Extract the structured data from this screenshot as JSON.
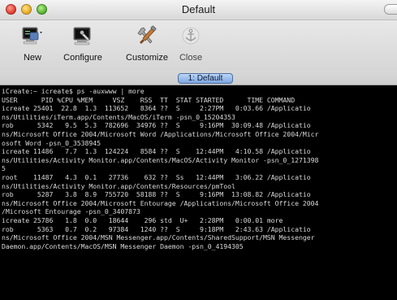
{
  "window": {
    "title": "Default"
  },
  "toolbar": {
    "new_label": "New",
    "configure_label": "Configure",
    "customize_label": "Customize",
    "close_label": "Close"
  },
  "tabs": [
    {
      "label": "1: Default"
    }
  ],
  "terminal": {
    "lines": [
      "iCreate:~ icreate$ ps -auxwww | more",
      "USER      PID %CPU %MEM     VSZ    RSS  TT  STAT STARTED      TIME COMMAND",
      "icreate 25401  22.8  1.3  113652   8364 ??  S     2:27PM   0:03.66 /Applicatio",
      "ns/Utilities/iTerm.app/Contents/MacOS/iTerm -psn_0_15204353",
      "rob      5342   9.5  5.3  782696  34976 ??  S     9:16PM  30:09.48 /Applicatio",
      "ns/Microsoft Office 2004/Microsoft Word /Applications/Microsoft Office 2004/Micr",
      "osoft Word -psn_0_3538945",
      "icreate 11486   7.7  1.3  124224   8584 ??  S    12:44PM   4:10.58 /Applicatio",
      "ns/Utilities/Activity Monitor.app/Contents/MacOS/Activity Monitor -psn_0_1271398",
      "5",
      "root    11487   4.3  0.1   27736    632 ??  Ss   12:44PM   3:06.22 /Applicatio",
      "ns/Utilities/Activity Monitor.app/Contents/Resources/pmTool",
      "rob      5287   3.8  8.9  755720  58188 ??  S     9:16PM  13:08.82 /Applicatio",
      "ns/Microsoft Office 2004/Microsoft Entourage /Applications/Microsoft Office 2004",
      "/Microsoft Entourage -psn_0_3407873",
      "icreate 25786   1.8  0.0   18644    296 std  U+   2:28PM   0:00.01 more",
      "rob      5363   0.7  0.2   97384   1240 ??  S     9:18PM   2:43.63 /Applicatio",
      "ns/Microsoft Office 2004/MSN Messenger.app/Contents/SharedSupport/MSN Messenger",
      "Daemon.app/Contents/MacOS/MSN Messenger Daemon -psn_0_4194305"
    ]
  }
}
